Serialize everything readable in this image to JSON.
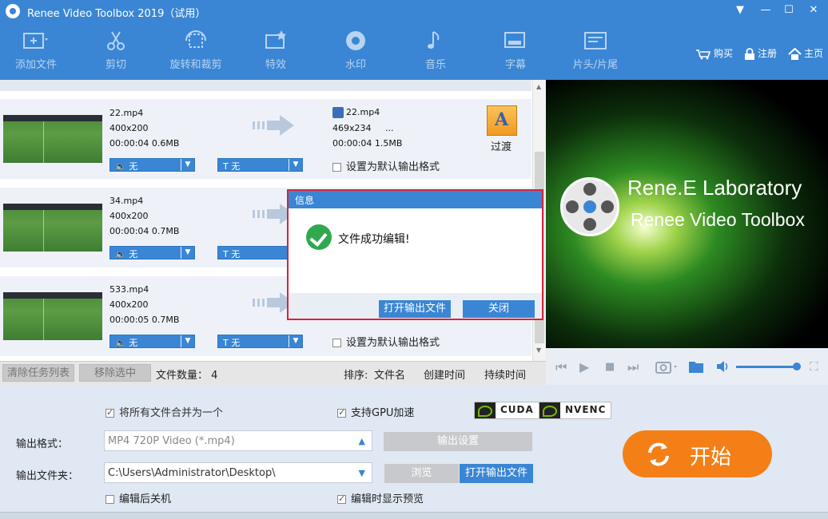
{
  "window": {
    "title": "Renee Video Toolbox 2019（试用）",
    "controls": [
      "▼",
      "—",
      "☐",
      "✕"
    ]
  },
  "toolbar": {
    "items": [
      {
        "label": "添加文件",
        "icon": "add-file-icon"
      },
      {
        "label": "剪切",
        "icon": "scissors-icon"
      },
      {
        "label": "旋转和裁剪",
        "icon": "rotate-crop-icon"
      },
      {
        "label": "特效",
        "icon": "effects-icon"
      },
      {
        "label": "水印",
        "icon": "watermark-icon"
      },
      {
        "label": "音乐",
        "icon": "music-icon"
      },
      {
        "label": "字幕",
        "icon": "subtitle-icon"
      },
      {
        "label": "片头/片尾",
        "icon": "intro-outro-icon"
      }
    ],
    "links": [
      {
        "label": "购买",
        "icon": "cart-icon"
      },
      {
        "label": "注册",
        "icon": "lock-icon"
      },
      {
        "label": "主页",
        "icon": "home-icon"
      }
    ]
  },
  "files": [
    {
      "name": "22.mp4",
      "resolution": "400x200",
      "duration": "00:00:04",
      "size": "0.6MB",
      "out_name": "22.mp4",
      "out_resolution": "469x234",
      "out_more": "...",
      "out_duration": "00:00:04",
      "out_size": "1.5MB",
      "audio": "无",
      "subtitle": "T 无",
      "default_label": "设置为默认输出格式",
      "transition": "过渡"
    },
    {
      "name": "34.mp4",
      "resolution": "400x200",
      "duration": "00:00:04",
      "size": "0.7MB",
      "audio": "无",
      "subtitle": "T 无"
    },
    {
      "name": "533.mp4",
      "resolution": "400x200",
      "duration": "00:00:05",
      "size": "0.7MB",
      "audio": "无",
      "subtitle": "T 无",
      "default_label": "设置为默认输出格式"
    }
  ],
  "list_footer": {
    "clear_label": "清除任务列表",
    "remove_label": "移除选中",
    "count_label": "文件数量：",
    "count": "4",
    "sort_label": "排序:",
    "sort_name": "文件名",
    "sort_created": "创建时间",
    "sort_duration": "持续时间"
  },
  "preview": {
    "line1": "Rene.E Laboratory",
    "line2": "Renee Video Toolbox",
    "volume": 0.95
  },
  "settings": {
    "merge_label": "将所有文件合并为一个",
    "merge_checked": true,
    "gpu_label": "支持GPU加速",
    "gpu_checked": true,
    "cuda": "CUDA",
    "nvenc": "NVENC",
    "format_label": "输出格式：",
    "format_value": "MP4 720P Video (*.mp4)",
    "output_settings_label": "输出设置",
    "folder_label": "输出文件夹：",
    "folder_value": "C:\\Users\\Administrator\\Desktop\\",
    "browse_label": "浏览",
    "open_output_label": "打开输出文件",
    "shutdown_label": "编辑后关机",
    "shutdown_checked": false,
    "preview_label": "编辑时显示预览",
    "preview_checked": true,
    "start_label": "开始"
  },
  "dialog": {
    "title": "信息",
    "message": "文件成功编辑!",
    "open_label": "打开输出文件",
    "close_label": "关闭"
  },
  "colors": {
    "brand_blue": "#3a86d4",
    "start_orange": "#f57f17",
    "success_green": "#2fa84f",
    "highlight_red": "#d9233b"
  }
}
